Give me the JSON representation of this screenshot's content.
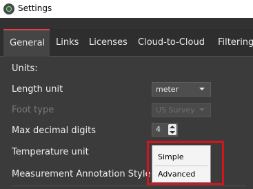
{
  "window": {
    "title": "Settings",
    "icon": "app-logo-icon"
  },
  "tabs": [
    {
      "label": "General",
      "active": true
    },
    {
      "label": "Links"
    },
    {
      "label": "Licenses"
    },
    {
      "label": "Cloud-to-Cloud"
    },
    {
      "label": "Filtering"
    }
  ],
  "general": {
    "section_label": "Units:",
    "length_unit": {
      "label": "Length unit",
      "value": "meter"
    },
    "foot_type": {
      "label": "Foot type",
      "value": "US Survey",
      "enabled": false
    },
    "max_decimal_digits": {
      "label": "Max decimal digits",
      "value": "4"
    },
    "temperature_unit": {
      "label": "Temperature unit"
    },
    "measurement_annotation_style": {
      "label": "Measurement Annotation Style",
      "options": [
        "Simple",
        "Advanced"
      ]
    }
  },
  "colors": {
    "accent": "#e0404a",
    "highlight": "#d4141c",
    "background": "#3b3b3b"
  }
}
